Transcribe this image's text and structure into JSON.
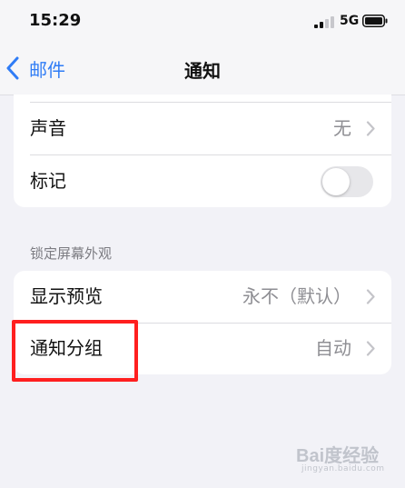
{
  "status_bar": {
    "time": "15:29",
    "network": "5G"
  },
  "nav": {
    "back_label": "邮件",
    "title": "通知"
  },
  "settings_top": {
    "sound": {
      "label": "声音",
      "value": "无"
    },
    "badges": {
      "label": "标记",
      "enabled": false
    }
  },
  "lock_screen_section": {
    "header": "锁定屏幕外观",
    "show_previews": {
      "label": "显示预览",
      "value": "永不（默认）"
    },
    "notification_grouping": {
      "label": "通知分组",
      "value": "自动"
    }
  },
  "watermark": {
    "text": "Bai度经验",
    "sub": "jingyan.baidu.com"
  },
  "colors": {
    "accent": "#2f7cf6",
    "highlight": "#ff1f1f",
    "background": "#f2f2f7"
  }
}
